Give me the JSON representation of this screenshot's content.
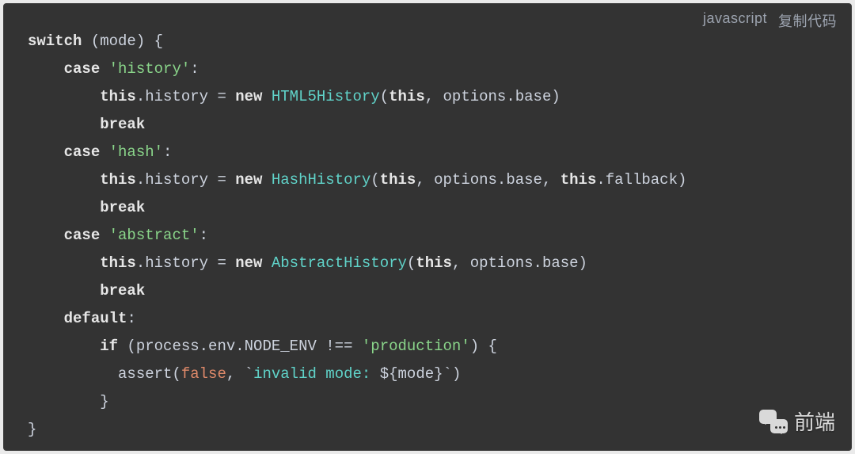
{
  "header": {
    "language_label": "javascript",
    "copy_label": "复制代码"
  },
  "code": {
    "line1": {
      "kw_switch": "switch",
      "rest": " (mode) {"
    },
    "line2": {
      "kw_case": "case",
      "sp": " ",
      "q1": "'",
      "str": "history",
      "q2": "'",
      "colon": ":"
    },
    "line3": {
      "kw_this": "this",
      "dot_hist": ".history = ",
      "kw_new": "new",
      "sp": " ",
      "cls": "HTML5History",
      "open": "(",
      "kw_this2": "this",
      "rest": ", options.base)"
    },
    "line4": {
      "kw_break": "break"
    },
    "line5": {
      "kw_case": "case",
      "sp": " ",
      "q1": "'",
      "str": "hash",
      "q2": "'",
      "colon": ":"
    },
    "line6": {
      "kw_this": "this",
      "dot_hist": ".history = ",
      "kw_new": "new",
      "sp": " ",
      "cls": "HashHistory",
      "open": "(",
      "kw_this2": "this",
      "mid": ", options.base, ",
      "kw_this3": "this",
      "rest": ".fallback)"
    },
    "line7": {
      "kw_break": "break"
    },
    "line8": {
      "kw_case": "case",
      "sp": " ",
      "q1": "'",
      "str": "abstract",
      "q2": "'",
      "colon": ":"
    },
    "line9": {
      "kw_this": "this",
      "dot_hist": ".history = ",
      "kw_new": "new",
      "sp": " ",
      "cls": "AbstractHistory",
      "open": "(",
      "kw_this2": "this",
      "rest": ", options.base)"
    },
    "line10": {
      "kw_break": "break"
    },
    "line11": {
      "kw_default": "default",
      "colon": ":"
    },
    "line12": {
      "kw_if": "if",
      "open": " (process.env.NODE_ENV !== ",
      "q1": "'",
      "str": "production",
      "q2": "'",
      "close": ") {"
    },
    "line13": {
      "pre": "  assert(",
      "false": "false",
      "mid": ", `",
      "msg": "invalid mode: ",
      "interp": "${mode}",
      "end": "`)"
    },
    "line14": {
      "brace": "}"
    },
    "line15": {
      "brace": "}"
    }
  },
  "watermark": {
    "text": "前端"
  }
}
